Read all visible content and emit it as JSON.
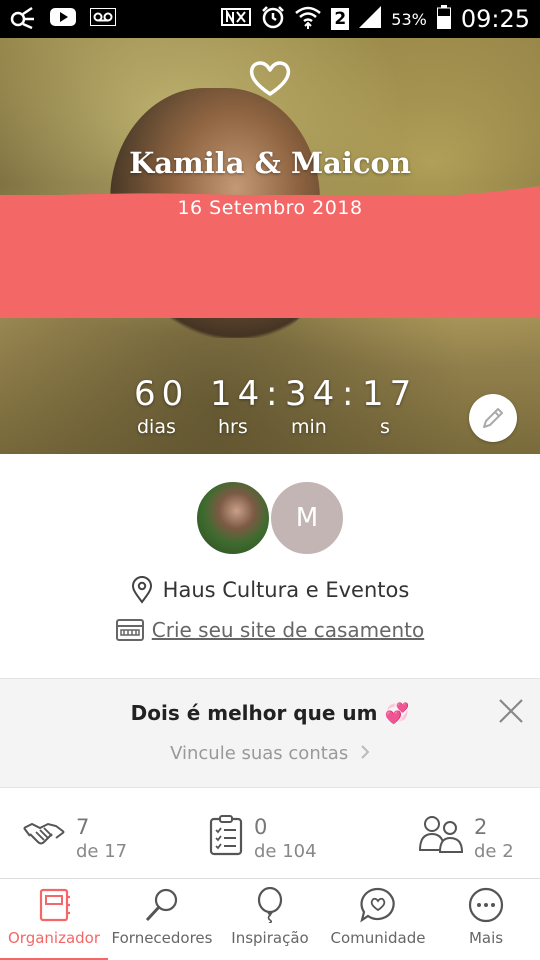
{
  "status_bar": {
    "battery_percent": "53%",
    "time": "09:25",
    "sim_badge": "2"
  },
  "hero": {
    "names": "Kamila & Maicon",
    "date": "16 Setembro 2018",
    "countdown": {
      "days": "60",
      "hours": "14",
      "minutes": "34",
      "seconds": "17",
      "days_label": "dias",
      "hours_label": "hrs",
      "minutes_label": "min",
      "seconds_label": "s"
    },
    "band_color": "#f46767"
  },
  "profile": {
    "partner_initial": "M",
    "venue": "Haus Cultura e Eventos",
    "website_link": "Crie seu site de casamento"
  },
  "banner": {
    "title": "Dois é melhor que um",
    "emoji": "💞",
    "subtitle": "Vincule suas contas"
  },
  "stats": [
    {
      "icon": "handshake-icon",
      "value": "7",
      "total": "de 17"
    },
    {
      "icon": "checklist-icon",
      "value": "0",
      "total": "de 104"
    },
    {
      "icon": "guests-icon",
      "value": "2",
      "total": "de 2"
    }
  ],
  "tabs": [
    {
      "label": "Organizador",
      "icon": "planner-icon",
      "active": true
    },
    {
      "label": "Fornecedores",
      "icon": "magnifier-icon",
      "active": false
    },
    {
      "label": "Inspiração",
      "icon": "balloon-icon",
      "active": false
    },
    {
      "label": "Comunidade",
      "icon": "chat-heart-icon",
      "active": false
    },
    {
      "label": "Mais",
      "icon": "more-icon",
      "active": false
    }
  ],
  "colors": {
    "accent": "#f46767",
    "avatar_bg": "#c4b5b5"
  }
}
